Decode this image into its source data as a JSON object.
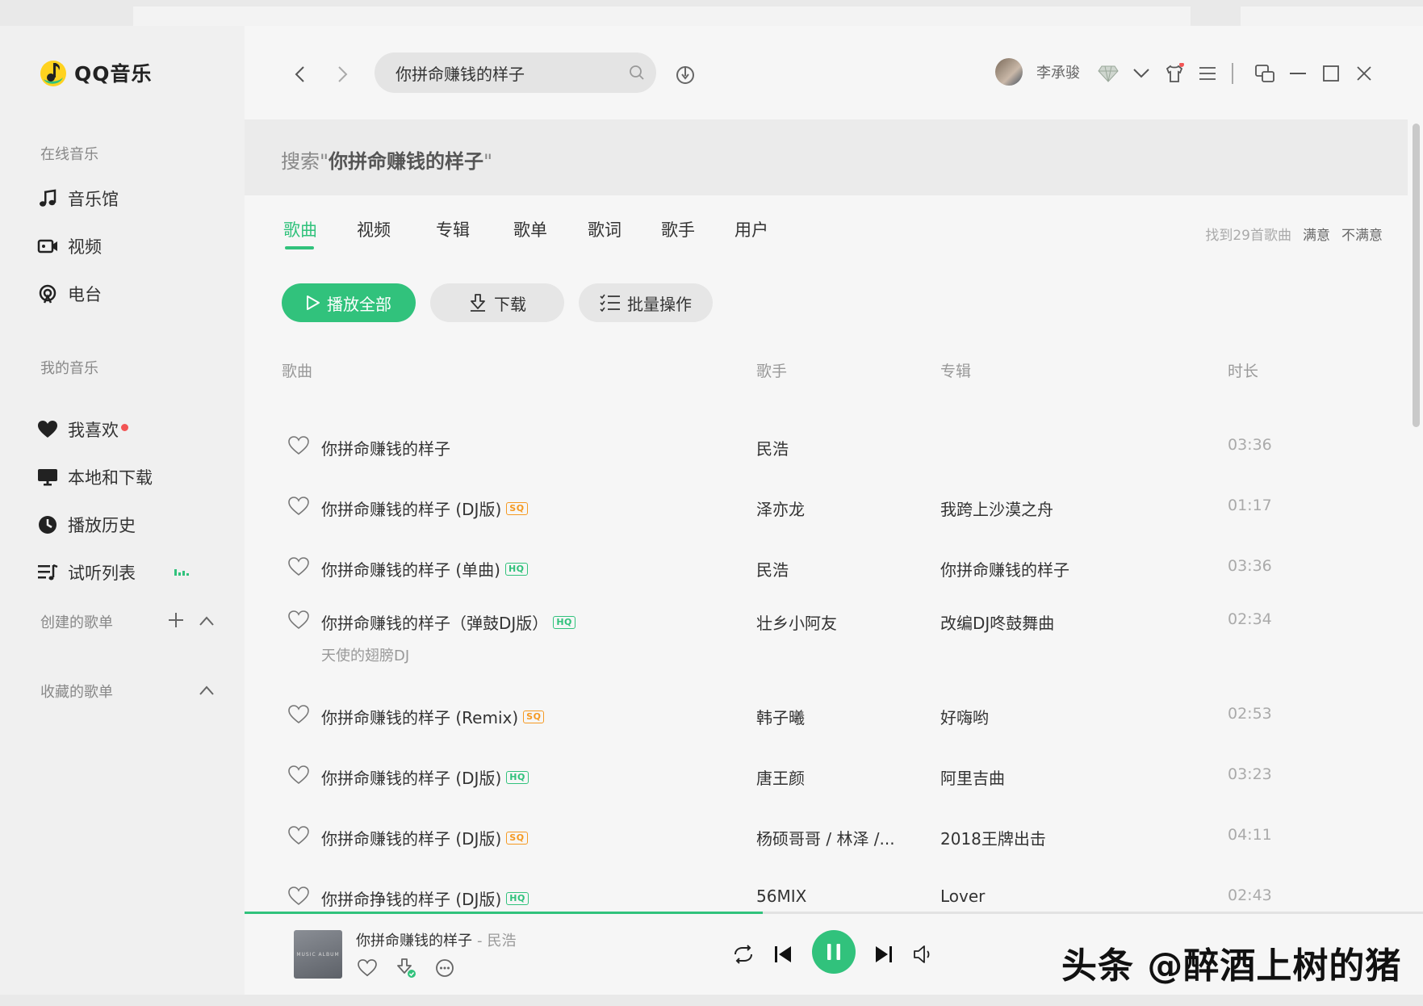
{
  "app": {
    "name": "QQ音乐"
  },
  "sidebar": {
    "online_title": "在线音乐",
    "online_items": [
      {
        "label": "音乐馆",
        "icon": "music-note-icon"
      },
      {
        "label": "视频",
        "icon": "video-icon"
      },
      {
        "label": "电台",
        "icon": "radio-icon"
      }
    ],
    "my_title": "我的音乐",
    "my_items": [
      {
        "label": "我喜欢",
        "icon": "heart-icon"
      },
      {
        "label": "本地和下载",
        "icon": "monitor-icon"
      },
      {
        "label": "播放历史",
        "icon": "clock-icon"
      },
      {
        "label": "试听列表",
        "icon": "playlist-icon"
      }
    ],
    "created_title": "创建的歌单",
    "collected_title": "收藏的歌单"
  },
  "topbar": {
    "search_value": "你拼命赚钱的样子",
    "username": "李承骏"
  },
  "search": {
    "prefix": "搜索\"",
    "query": "你拼命赚钱的样子",
    "suffix": "\""
  },
  "tabs": [
    "歌曲",
    "视频",
    "专辑",
    "歌单",
    "歌词",
    "歌手",
    "用户"
  ],
  "active_tab": "歌曲",
  "result_meta": {
    "count": "找到29首歌曲",
    "satisfied": "满意",
    "unsatisfied": "不满意"
  },
  "actions": {
    "play_all": "播放全部",
    "download": "下载",
    "batch": "批量操作"
  },
  "columns": {
    "song": "歌曲",
    "artist": "歌手",
    "album": "专辑",
    "duration": "时长"
  },
  "songs": [
    {
      "title": "你拼命赚钱的样子",
      "quality": "",
      "artist": "民浩",
      "album": "",
      "duration": "03:36"
    },
    {
      "title": "你拼命赚钱的样子 (DJ版)",
      "quality": "SQ",
      "artist": "泽亦龙",
      "album": "我跨上沙漠之舟",
      "duration": "01:17"
    },
    {
      "title": "你拼命赚钱的样子 (单曲)",
      "quality": "HQ",
      "artist": "民浩",
      "album": "你拼命赚钱的样子",
      "duration": "03:36"
    },
    {
      "title": "你拼命赚钱的样子（弹鼓DJ版）",
      "quality": "HQ",
      "artist": "壮乡小阿友",
      "album": "改编DJ咚鼓舞曲",
      "duration": "02:34",
      "subtitle": "天使的翅膀DJ"
    },
    {
      "title": "你拼命赚钱的样子 (Remix)",
      "quality": "SQ",
      "artist": "韩子曦",
      "album": "好嗨哟",
      "duration": "02:53"
    },
    {
      "title": "你拼命赚钱的样子 (DJ版)",
      "quality": "HQ",
      "artist": "唐王颜",
      "album": "阿里吉曲",
      "duration": "03:23"
    },
    {
      "title": "你拼命赚钱的样子 (DJ版)",
      "quality": "SQ",
      "artist": "杨硕哥哥 / 林泽 /...",
      "album": "2018王牌出击",
      "duration": "04:11"
    },
    {
      "title": "你拼命挣钱的样子 (DJ版)",
      "quality": "HQ",
      "artist": "56MIX",
      "album": "Lover",
      "duration": "02:43"
    }
  ],
  "player": {
    "title": "你拼命赚钱的样子",
    "separator": "-",
    "artist": "民浩",
    "cover_text": "MUSIC ALBUM",
    "progress": 0.44
  },
  "watermark": "头条 @醉酒上树的猪",
  "colors": {
    "accent": "#31c27c",
    "sq": "#f59a23",
    "hq": "#31c27c",
    "red_dot": "#f25454"
  }
}
